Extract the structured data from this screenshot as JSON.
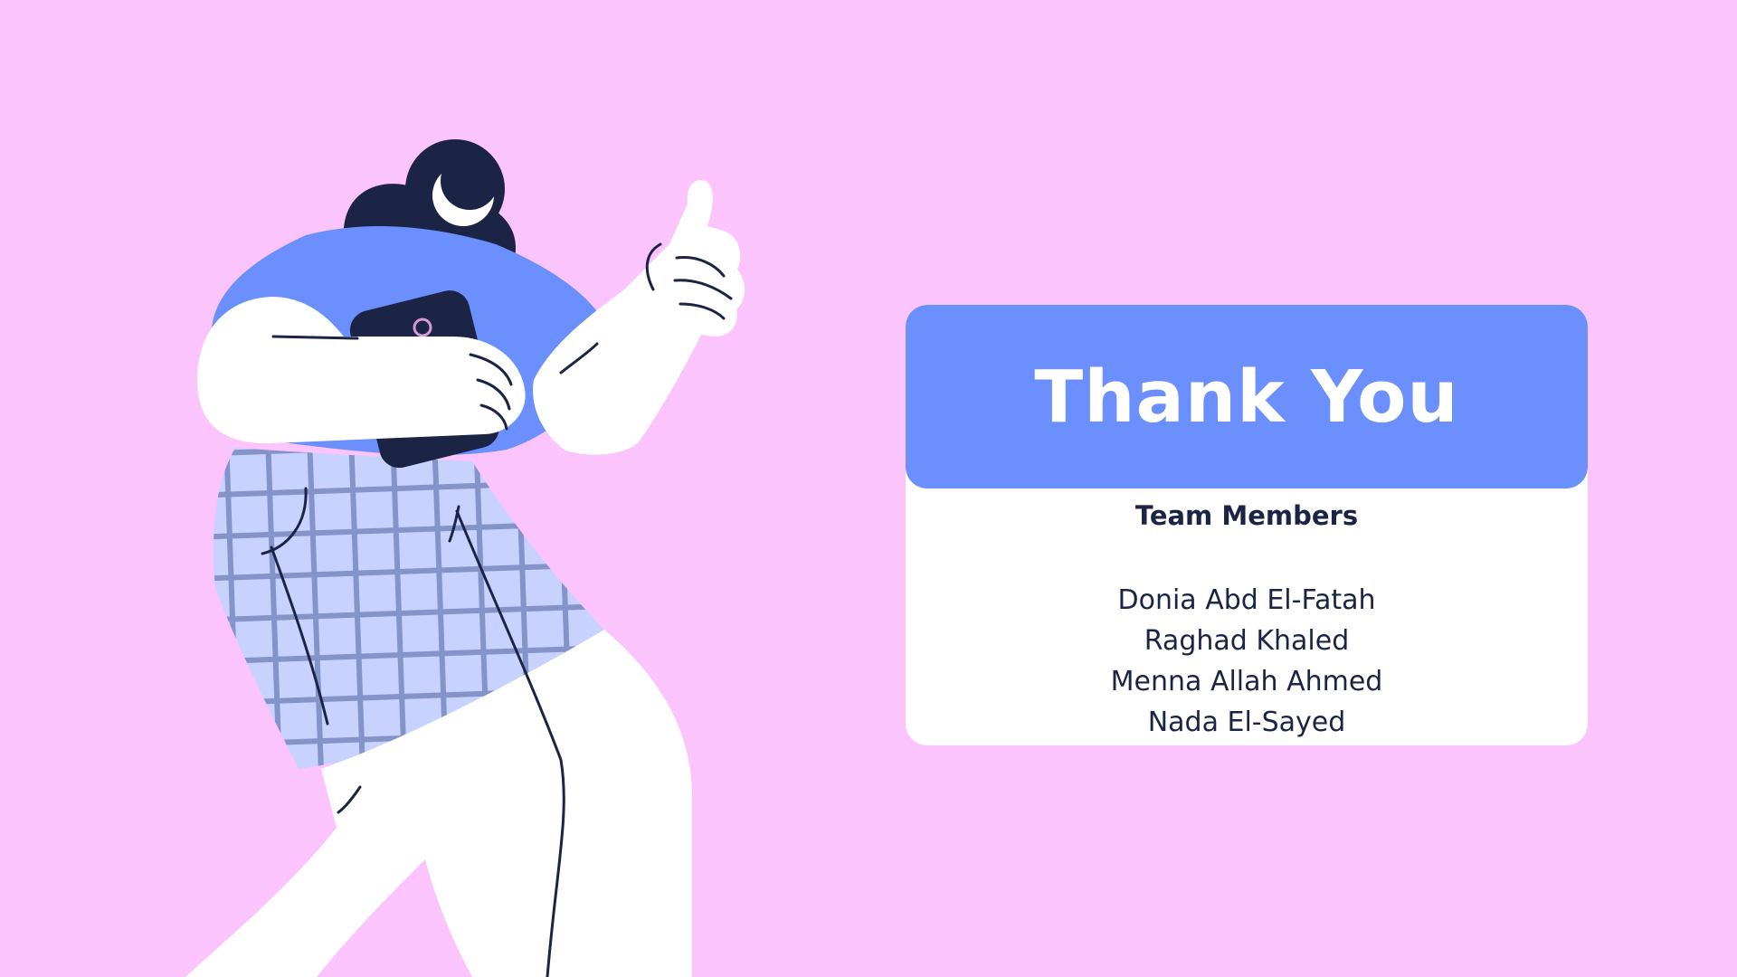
{
  "slide": {
    "title": "Thank You",
    "team_heading": "Team Members",
    "members": [
      "Donia Abd El-Fatah",
      "Raghad Khaled",
      "Menna Allah Ahmed",
      "Nada El-Sayed"
    ]
  },
  "illustration": {
    "subject": "woman-thumbs-up-holding-phone-illustration"
  },
  "colors": {
    "background": "#fcc4fd",
    "header": "#6b8ffd",
    "card": "#ffffff",
    "text_dark": "#1b2444",
    "shirt_checks": "#c8d2ff",
    "shirt_lines": "#8493c8",
    "outline": "#1b2444"
  }
}
